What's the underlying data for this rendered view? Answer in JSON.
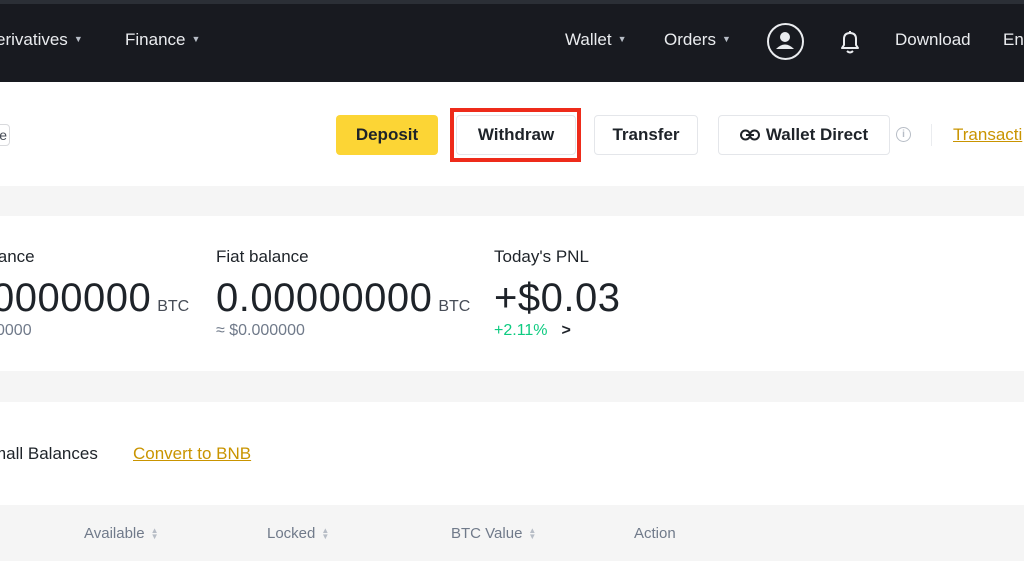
{
  "header": {
    "nav_left": [
      {
        "label": "erivatives"
      },
      {
        "label": "Finance"
      }
    ],
    "nav_right": [
      {
        "label": "Wallet"
      },
      {
        "label": "Orders"
      }
    ],
    "download_label": "Download",
    "language_label": "Eng"
  },
  "actions": {
    "left_chip_text": "e",
    "deposit_label": "Deposit",
    "withdraw_label": "Withdraw",
    "transfer_label": "Transfer",
    "wallet_direct_label": "Wallet Direct",
    "info_icon_text": "i",
    "transaction_link": "Transacti"
  },
  "balances": {
    "estimated": {
      "label": "lance",
      "amount": "0000000",
      "unit": "BTC",
      "sub": "0000"
    },
    "fiat": {
      "label": "Fiat balance",
      "amount": "0.00000000",
      "unit": "BTC",
      "sub": "≈ $0.000000"
    },
    "pnl": {
      "label": "Today's PNL",
      "amount": "+$0.03",
      "change": "+2.11%",
      "arrow": ">"
    }
  },
  "assets": {
    "hide_small_label": "mall Balances",
    "convert_link": "Convert to BNB",
    "columns": [
      "Available",
      "Locked",
      "BTC Value",
      "Action"
    ]
  },
  "colors": {
    "brand_yellow": "#fcd535",
    "link_gold": "#c99400",
    "positive_green": "#0ecb81",
    "highlight_red": "#ee2b1a",
    "topbar_bg": "#181a20"
  },
  "icons": [
    "user-avatar-icon",
    "bell-icon",
    "link-icon",
    "info-icon",
    "caret-down-icon",
    "sort-icon"
  ]
}
